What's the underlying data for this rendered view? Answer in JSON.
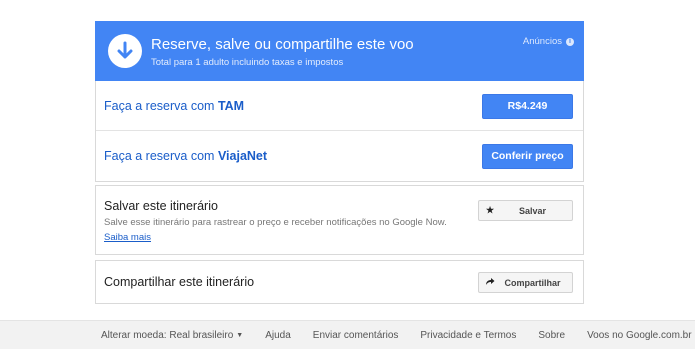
{
  "header": {
    "title": "Reserve, salve ou compartilhe este voo",
    "subtitle": "Total para 1 adulto incluindo taxas e impostos",
    "ads_label": "Anúncios",
    "icon": "download-arrow-icon",
    "accent_color": "#4285f4"
  },
  "booking": [
    {
      "prefix": "Faça a reserva com ",
      "provider": "TAM",
      "button_label": "R$4.249"
    },
    {
      "prefix": "Faça a reserva com ",
      "provider": "ViajaNet",
      "button_label": "Conferir preço"
    }
  ],
  "save": {
    "title": "Salvar este itinerário",
    "description": "Salve esse itinerário para rastrear o preço e receber notificações no Google Now.",
    "link": "Saiba mais",
    "button_label": "Salvar",
    "button_icon": "star-icon"
  },
  "share": {
    "title": "Compartilhar este itinerário",
    "button_label": "Compartilhar",
    "button_icon": "share-arrow-icon"
  },
  "footer": {
    "currency": "Alterar moeda: Real brasileiro",
    "help": "Ajuda",
    "feedback": "Enviar comentários",
    "privacy": "Privacidade e Termos",
    "about": "Sobre",
    "domain": "Voos no Google.com.br"
  }
}
